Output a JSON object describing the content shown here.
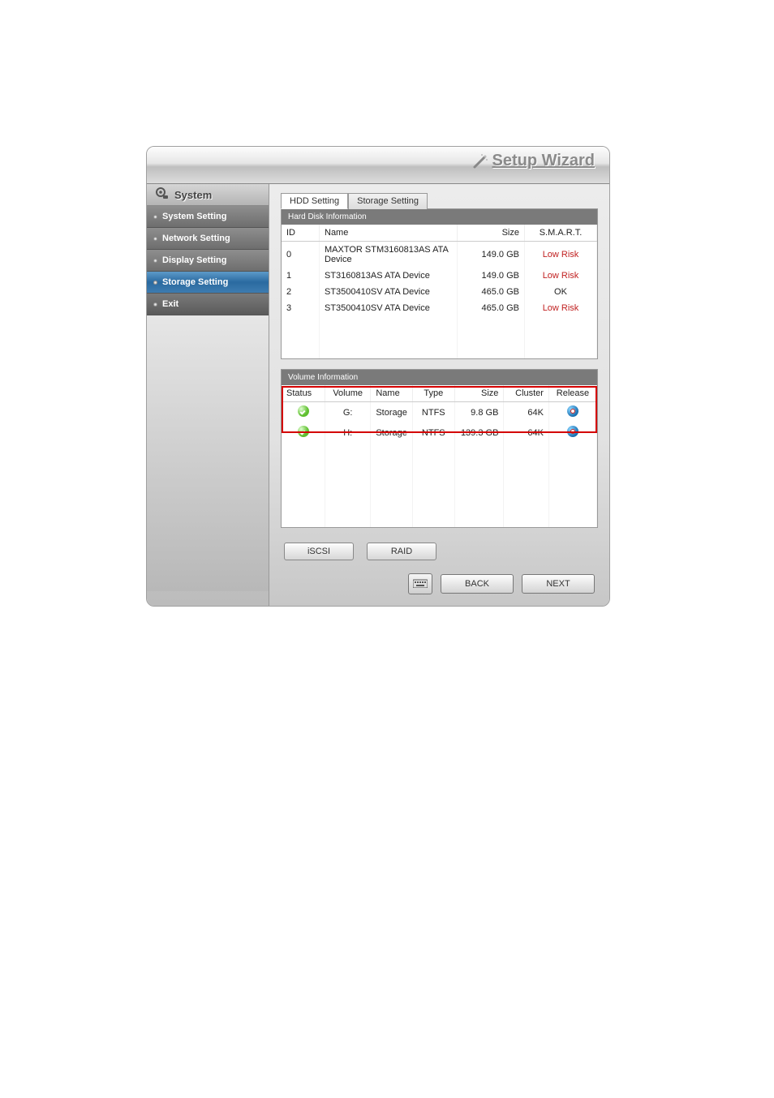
{
  "title": "Setup Wizard",
  "sidebar": {
    "header": "System",
    "items": [
      {
        "label": "System Setting"
      },
      {
        "label": "Network Setting"
      },
      {
        "label": "Display Setting"
      },
      {
        "label": "Storage Setting"
      },
      {
        "label": "Exit"
      }
    ],
    "active_index": 3
  },
  "tabs": {
    "items": [
      {
        "label": "HDD Setting"
      },
      {
        "label": "Storage Setting"
      }
    ],
    "active_index": 0
  },
  "hdd_section": {
    "title": "Hard Disk Information",
    "columns": {
      "id": "ID",
      "name": "Name",
      "size": "Size",
      "smart": "S.M.A.R.T."
    },
    "rows": [
      {
        "id": "0",
        "name": "MAXTOR STM3160813AS ATA Device",
        "size": "149.0 GB",
        "smart": "Low Risk",
        "smart_status": "low"
      },
      {
        "id": "1",
        "name": "ST3160813AS ATA Device",
        "size": "149.0 GB",
        "smart": "Low Risk",
        "smart_status": "low"
      },
      {
        "id": "2",
        "name": "ST3500410SV ATA Device",
        "size": "465.0 GB",
        "smart": "OK",
        "smart_status": "ok"
      },
      {
        "id": "3",
        "name": "ST3500410SV ATA Device",
        "size": "465.0 GB",
        "smart": "Low Risk",
        "smart_status": "low"
      }
    ]
  },
  "volume_section": {
    "title": "Volume Information",
    "columns": {
      "status": "Status",
      "volume": "Volume",
      "name": "Name",
      "type": "Type",
      "size": "Size",
      "cluster": "Cluster",
      "release": "Release"
    },
    "rows": [
      {
        "status": "ok",
        "volume": "G:",
        "name": "Storage",
        "type": "NTFS",
        "size": "9.8 GB",
        "cluster": "64K"
      },
      {
        "status": "ok",
        "volume": "H:",
        "name": "Storage",
        "type": "NTFS",
        "size": "139.3 GB",
        "cluster": "64K"
      }
    ]
  },
  "sub_actions": {
    "iscsi": "iSCSI",
    "raid": "RAID"
  },
  "footer": {
    "back": "BACK",
    "next": "NEXT"
  }
}
